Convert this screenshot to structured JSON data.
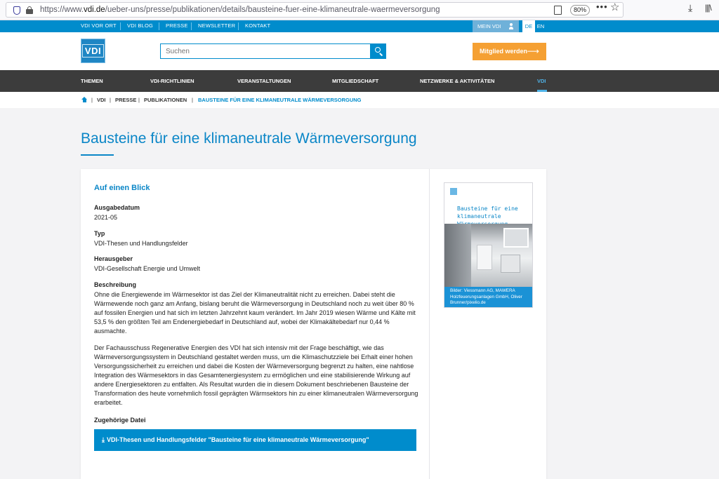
{
  "browser": {
    "url_prefix": "https://www.",
    "url_domain": "vdi.de",
    "url_path": "/ueber-uns/presse/publikationen/details/bausteine-fuer-eine-klimaneutrale-waermeversorgung",
    "zoom": "80%",
    "icons": [
      "shield-icon",
      "lock-icon",
      "reader-icon",
      "more-icon",
      "star-icon",
      "download-icon",
      "library-icon"
    ]
  },
  "top_nav": {
    "items": [
      "VDI VOR ORT",
      "VDI BLOG",
      "PRESSE",
      "NEWSLETTER",
      "KONTAKT"
    ],
    "mein_vdi": "MEIN VDI",
    "lang_de": "DE",
    "lang_en": "EN"
  },
  "header": {
    "logo_text": "VDI",
    "search_placeholder": "Suchen",
    "member_button": "Mitglied werden",
    "member_arrow": "⟶"
  },
  "main_nav": {
    "items": [
      "THEMEN",
      "VDI-RICHTLINIEN",
      "VERANSTALTUNGEN",
      "MITGLIEDSCHAFT",
      "NETZWERKE & AKTIVITÄTEN",
      "VDI"
    ],
    "active_index": 5
  },
  "breadcrumb": {
    "items": [
      "VDI",
      "PRESSE",
      "PUBLIKATIONEN",
      "BAUSTEINE FÜR EINE KLIMANEUTRALE WÄRMEVERSORGUNG"
    ],
    "separator": "|"
  },
  "page": {
    "title": "Bausteine für eine klimaneutrale Wärmeversorgung",
    "section_heading": "Auf einen Blick",
    "fields": {
      "ausgabedatum_label": "Ausgabedatum",
      "ausgabedatum_value": "2021-05",
      "typ_label": "Typ",
      "typ_value": "VDI-Thesen und Handlungsfelder",
      "herausgeber_label": "Herausgeber",
      "herausgeber_value": "VDI-Gesellschaft Energie und Umwelt",
      "beschreibung_label": "Beschreibung",
      "beschreibung_p1": "Ohne die Energiewende im Wärmesektor ist das Ziel der Klimaneutralität nicht zu erreichen. Dabei steht die Wärmewende noch ganz am Anfang, bislang beruht die Wärmeversorgung in Deutschland noch zu weit über 80 % auf fossilen Energien und hat sich im letzten Jahrzehnt kaum verändert. Im Jahr 2019 wiesen Wärme und Kälte mit 53,5 % den größten Teil am Endenergiebedarf in Deutschland auf, wobei der Klimakältebedarf nur 0,44 % ausmachte.",
      "beschreibung_p2": "Der Fachausschuss Regenerative Energien des VDI hat sich intensiv mit der Frage beschäftigt, wie das Wärmeversorgungssystem in Deutschland gestaltet werden muss, um die Klimaschutzziele bei Erhalt einer hohen Versorgungssicherheit zu erreichen und dabei die Kosten der Wärmeversorgung begrenzt zu halten, eine nahtlose Integration des Wärmesektors in das Gesamtenergiesystem zu ermöglichen und eine stabilisierende Wirkung auf andere Energiesektoren zu entfalten. Als Resultat wurden die in diesem Dokument beschriebenen Bausteine der Transformation des heute vornehmlich fossil geprägten Wärmsektors hin zu einer klimaneutralen Wärmeversorgung erarbeitet.",
      "datei_label": "Zugehörige Datei"
    },
    "download_button": "VDI-Thesen und Handlungsfelder \"Bausteine für eine klimaneutrale Wärmeversorgung\"",
    "cover": {
      "title": "Bausteine für eine klimaneutrale Wärmeversorgung",
      "caption": "Bilder: Viessmann AG, MAWERA Holzfeuerungsanlagen GmbH, Oliver Brunner/pixelio.de"
    }
  }
}
